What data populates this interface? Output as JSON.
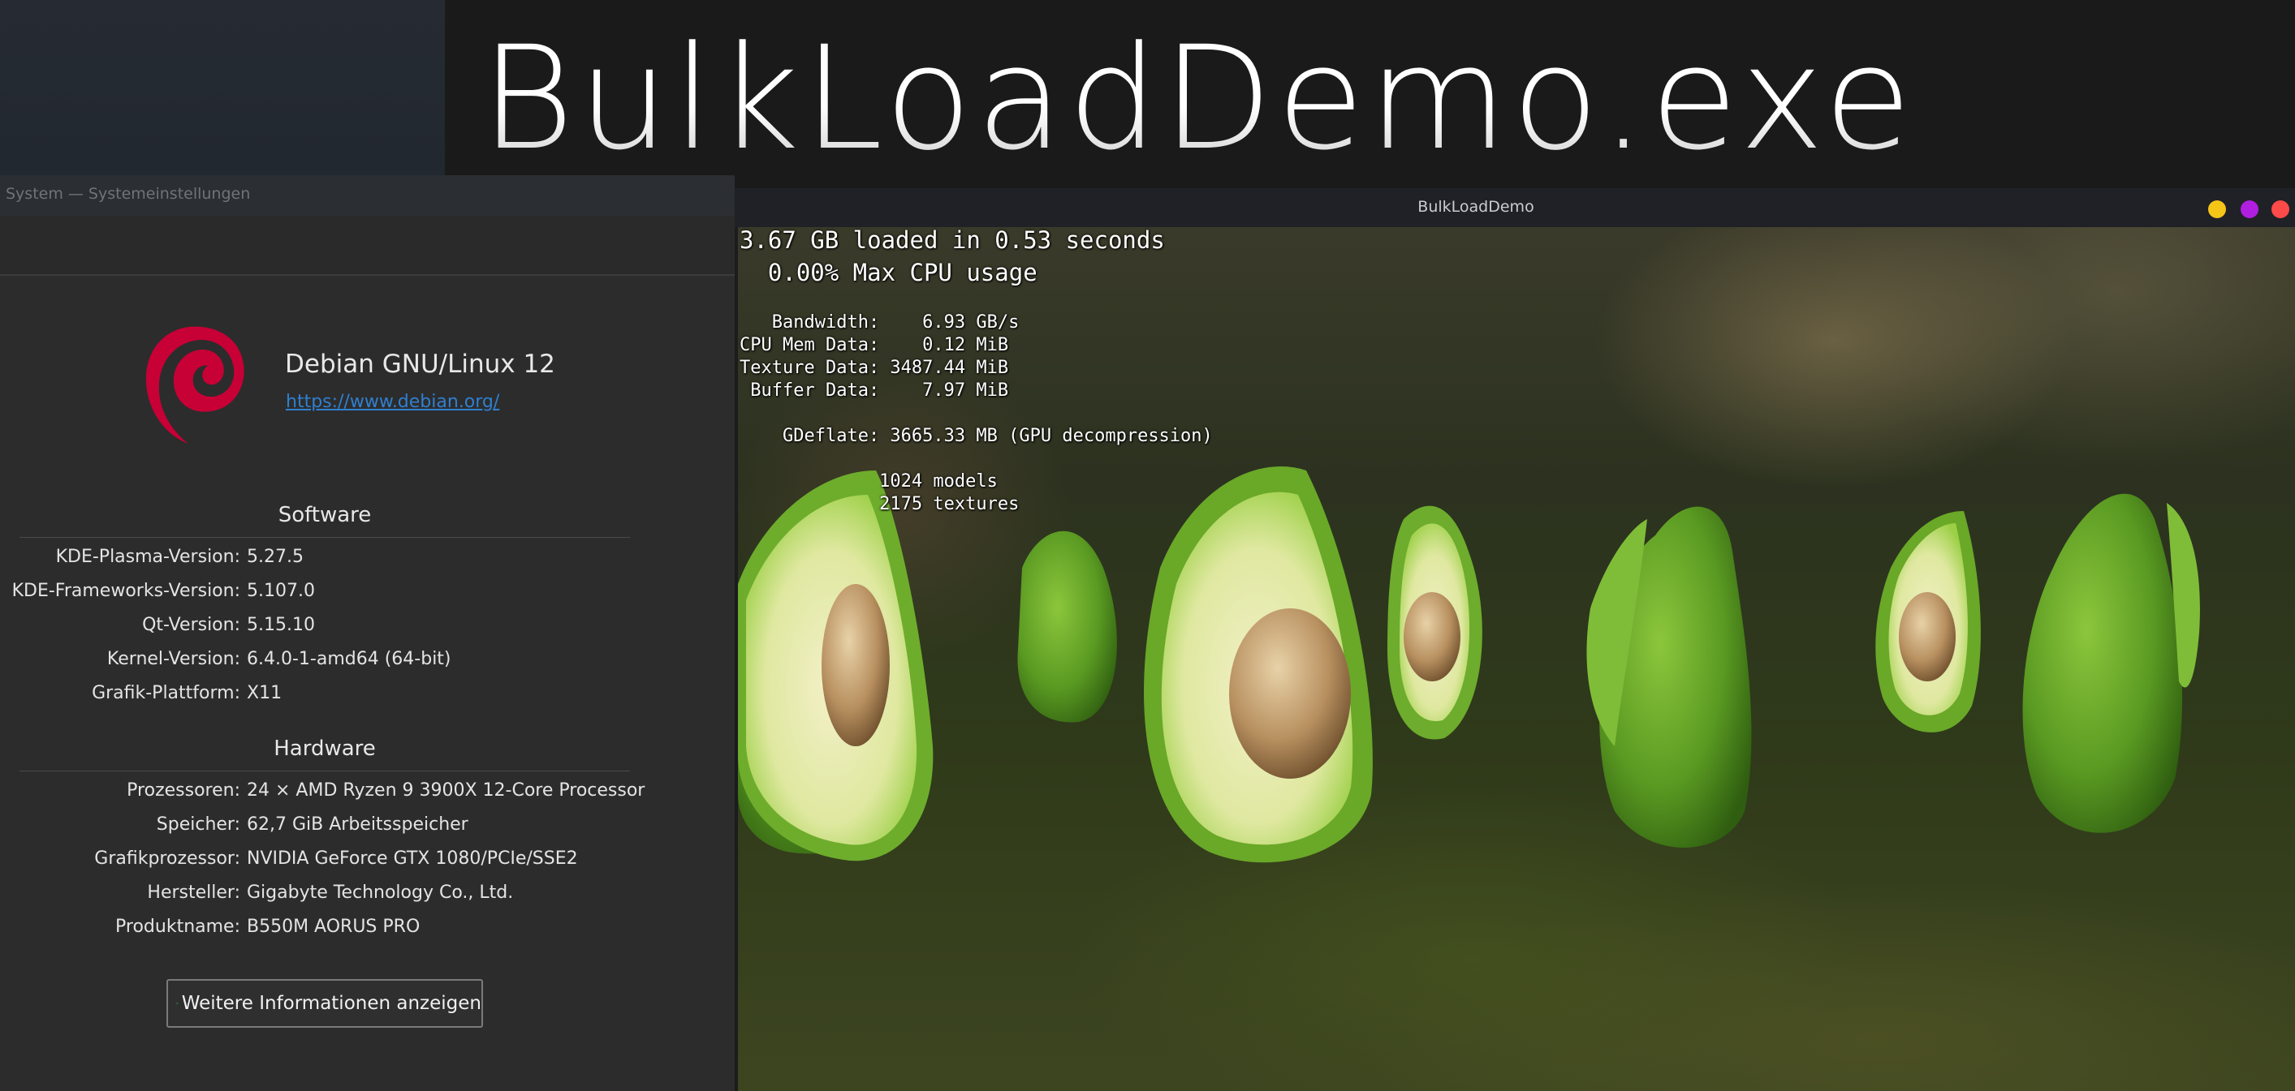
{
  "banner": {
    "title": "BulkLoadDemo.exe"
  },
  "kde_window": {
    "title": "System — Systemeinstellungen",
    "distro_name": "Debian GNU/Linux 12",
    "distro_url": "https://www.debian.org/",
    "software": {
      "heading": "Software",
      "rows": [
        {
          "label": "KDE-Plasma-Version:",
          "value": "5.27.5"
        },
        {
          "label": "KDE-Frameworks-Version:",
          "value": "5.107.0"
        },
        {
          "label": "Qt-Version:",
          "value": "5.15.10"
        },
        {
          "label": "Kernel-Version:",
          "value": "6.4.0-1-amd64 (64-bit)"
        },
        {
          "label": "Grafik-Plattform:",
          "value": "X11"
        }
      ]
    },
    "hardware": {
      "heading": "Hardware",
      "rows": [
        {
          "label": "Prozessoren:",
          "value": "24 × AMD Ryzen 9 3900X 12-Core Processor"
        },
        {
          "label": "Speicher:",
          "value": "62,7 GiB Arbeitsspeicher"
        },
        {
          "label": "Grafikprozessor:",
          "value": "NVIDIA GeForce GTX 1080/PCIe/SSE2"
        },
        {
          "label": "Hersteller:",
          "value": "Gigabyte Technology Co., Ltd."
        },
        {
          "label": "Produktname:",
          "value": "B550M AORUS PRO"
        }
      ]
    },
    "more_info_button": "Weitere Informationen anzeigen",
    "colors": {
      "debian_red": "#c70036",
      "link": "#2f7fd0"
    }
  },
  "demo_window": {
    "title": "BulkLoadDemo",
    "buttons": {
      "minimize_color": "#f5c518",
      "maximize_color": "#b01ee0",
      "close_color": "#ff4a4a"
    },
    "hud": {
      "line1": "3.67 GB loaded in 0.53 seconds",
      "line2": "  0.00% Max CPU usage",
      "bandwidth": "   Bandwidth:    6.93 GB/s",
      "cpu_mem": "CPU Mem Data:    0.12 MiB",
      "texture": "Texture Data: 3487.44 MiB",
      "buffer": " Buffer Data:    7.97 MiB",
      "gdeflate": "    GDeflate: 3665.33 MB (GPU decompression)",
      "models": "             1024 models",
      "textures": "             2175 textures"
    }
  }
}
